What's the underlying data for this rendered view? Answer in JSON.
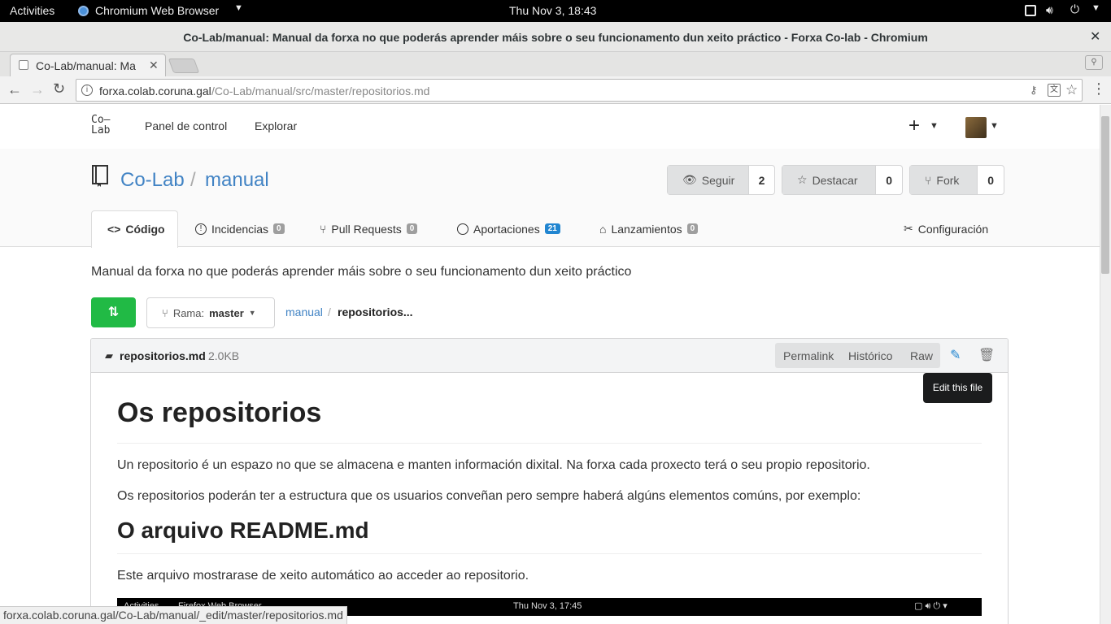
{
  "system_bar": {
    "activities": "Activities",
    "app_name": "Chromium Web Browser",
    "clock": "Thu Nov  3, 18:43"
  },
  "window": {
    "title": "Co-Lab/manual: Manual da forxa no que poderás aprender máis sobre o seu funcionamento dun xeito práctico - Forxa Co-lab - Chromium"
  },
  "browser": {
    "tab_title": "Co-Lab/manual: Ma",
    "url_host": "forxa.colab.coruna.gal",
    "url_path": "/Co-Lab/manual/src/master/repositorios.md",
    "status_url": "forxa.colab.coruna.gal/Co-Lab/manual/_edit/master/repositorios.md"
  },
  "site_nav": {
    "logo_line1": "Co–",
    "logo_line2": "Lab",
    "items": [
      "Panel de control",
      "Explorar"
    ],
    "plus": "+"
  },
  "repo": {
    "owner": "Co-Lab",
    "separator": "/",
    "name": "manual",
    "watch_label": "Seguir",
    "watch_count": "2",
    "star_label": "Destacar",
    "star_count": "0",
    "fork_label": "Fork",
    "fork_count": "0",
    "tabs": [
      {
        "label": "Código"
      },
      {
        "label": "Incidencias",
        "count": "0"
      },
      {
        "label": "Pull Requests",
        "count": "0"
      },
      {
        "label": "Aportaciones",
        "count": "21"
      },
      {
        "label": "Lanzamientos",
        "count": "0"
      }
    ],
    "settings": "Configuración",
    "description": "Manual da forxa no que poderás aprender máis sobre o seu funcionamento dun xeito práctico"
  },
  "branch": {
    "label": "Rama:",
    "value": "master"
  },
  "path": {
    "root": "manual",
    "sep": "/",
    "current": "repositorios..."
  },
  "file": {
    "name": "repositorios.md",
    "size": "2.0KB",
    "permalink": "Permalink",
    "history": "Histórico",
    "raw": "Raw",
    "tooltip": "Edit this file"
  },
  "content": {
    "h1": "Os repositorios",
    "p1": "Un repositorio é un espazo no que se almacena e manten información dixital. Na forxa cada proxecto terá o seu propio repositorio.",
    "p2": "Os repositorios poderán ter a estructura que os usuarios conveñan pero sempre haberá algúns elementos comúns, por exemplo:",
    "h2": "O arquivo README.md",
    "p3": "Este arquivo mostrarase de xeito automático ao acceder ao repositorio.",
    "embedded": {
      "activities": "Activities",
      "browser": "Firefox Web Browser",
      "clock": "Thu Nov  3, 17:45"
    }
  },
  "colors": {
    "link": "#4183c4",
    "green": "#21ba45",
    "tooltip_bg": "#1b1c1d"
  }
}
